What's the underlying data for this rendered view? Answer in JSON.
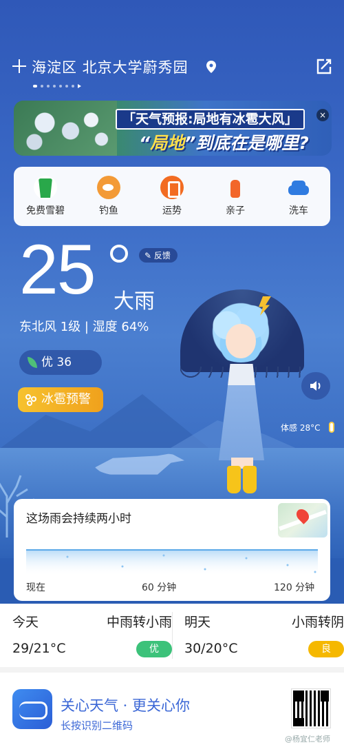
{
  "header": {
    "location": "海淀区 北京大学蔚秀园",
    "page_dots": 8
  },
  "banner": {
    "line1": "「天气预报:局地有冰雹大风」",
    "line2_a": "“",
    "line2_highlight": "局地",
    "line2_b": "”到底在是哪里?",
    "close": "×"
  },
  "shortcuts": [
    {
      "label": "免费雪碧",
      "icon": "soda-cup-icon"
    },
    {
      "label": "钓鱼",
      "icon": "fish-icon"
    },
    {
      "label": "运势",
      "icon": "fortune-icon"
    },
    {
      "label": "亲子",
      "icon": "baby-bottle-icon"
    },
    {
      "label": "洗车",
      "icon": "car-wash-icon"
    }
  ],
  "current": {
    "temperature": "25",
    "condition": "大雨",
    "wind_humidity": "东北风 1级 | 湿度 64%",
    "aqi": "优 36",
    "alert": "冰雹预警",
    "feedback": "反馈",
    "feels_like": "体感 28°C"
  },
  "nowcast": {
    "title": "这场雨会持续两小时",
    "x_labels": [
      "现在",
      "60 分钟",
      "120 分钟"
    ],
    "accent": "#5aa8e8"
  },
  "forecast": [
    {
      "day": "今天",
      "condition": "中雨转小雨",
      "temp": "29/21°C",
      "aqi": "优",
      "aqi_color": "#3cc27a"
    },
    {
      "day": "明天",
      "condition": "小雨转阴",
      "temp": "30/20°C",
      "aqi": "良",
      "aqi_color": "#f5b800"
    }
  ],
  "footer": {
    "slogan": "关心天气 · 更关心你",
    "sub": "长按识别二维码",
    "watermark": "@杨宜仁老师"
  }
}
